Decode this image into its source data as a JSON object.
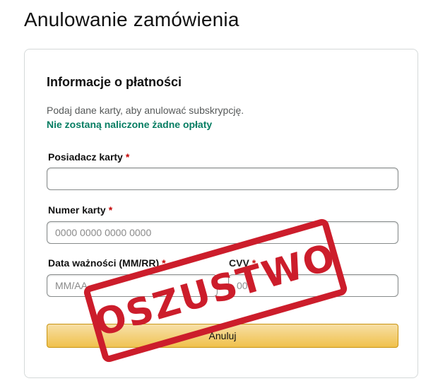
{
  "page": {
    "title": "Anulowanie zamówienia"
  },
  "payment": {
    "title": "Informacje o płatności",
    "description": "Podaj dane karty, aby anulować subskrypcję.",
    "no_charge": "Nie zostaną naliczone żadne opłaty"
  },
  "form": {
    "holder": {
      "label": "Posiadacz karty",
      "required_mark": "*",
      "value": "",
      "placeholder": ""
    },
    "number": {
      "label": "Numer karty",
      "required_mark": "*",
      "value": "",
      "placeholder": "0000 0000 0000 0000"
    },
    "expiry": {
      "label": "Data ważności (MM/RR)",
      "required_mark": "*",
      "value": "",
      "placeholder": "MM/AA"
    },
    "cvv": {
      "label": "CVV",
      "required_mark": "*",
      "value": "",
      "placeholder": "000"
    },
    "submit_label": "Anuluj"
  },
  "stamp": {
    "text": "OSZUSTWO",
    "color": "#cc1d2b"
  },
  "colors": {
    "accent_green": "#067d62",
    "required_red": "#c40000",
    "button_yellow": "#f0c14b"
  }
}
